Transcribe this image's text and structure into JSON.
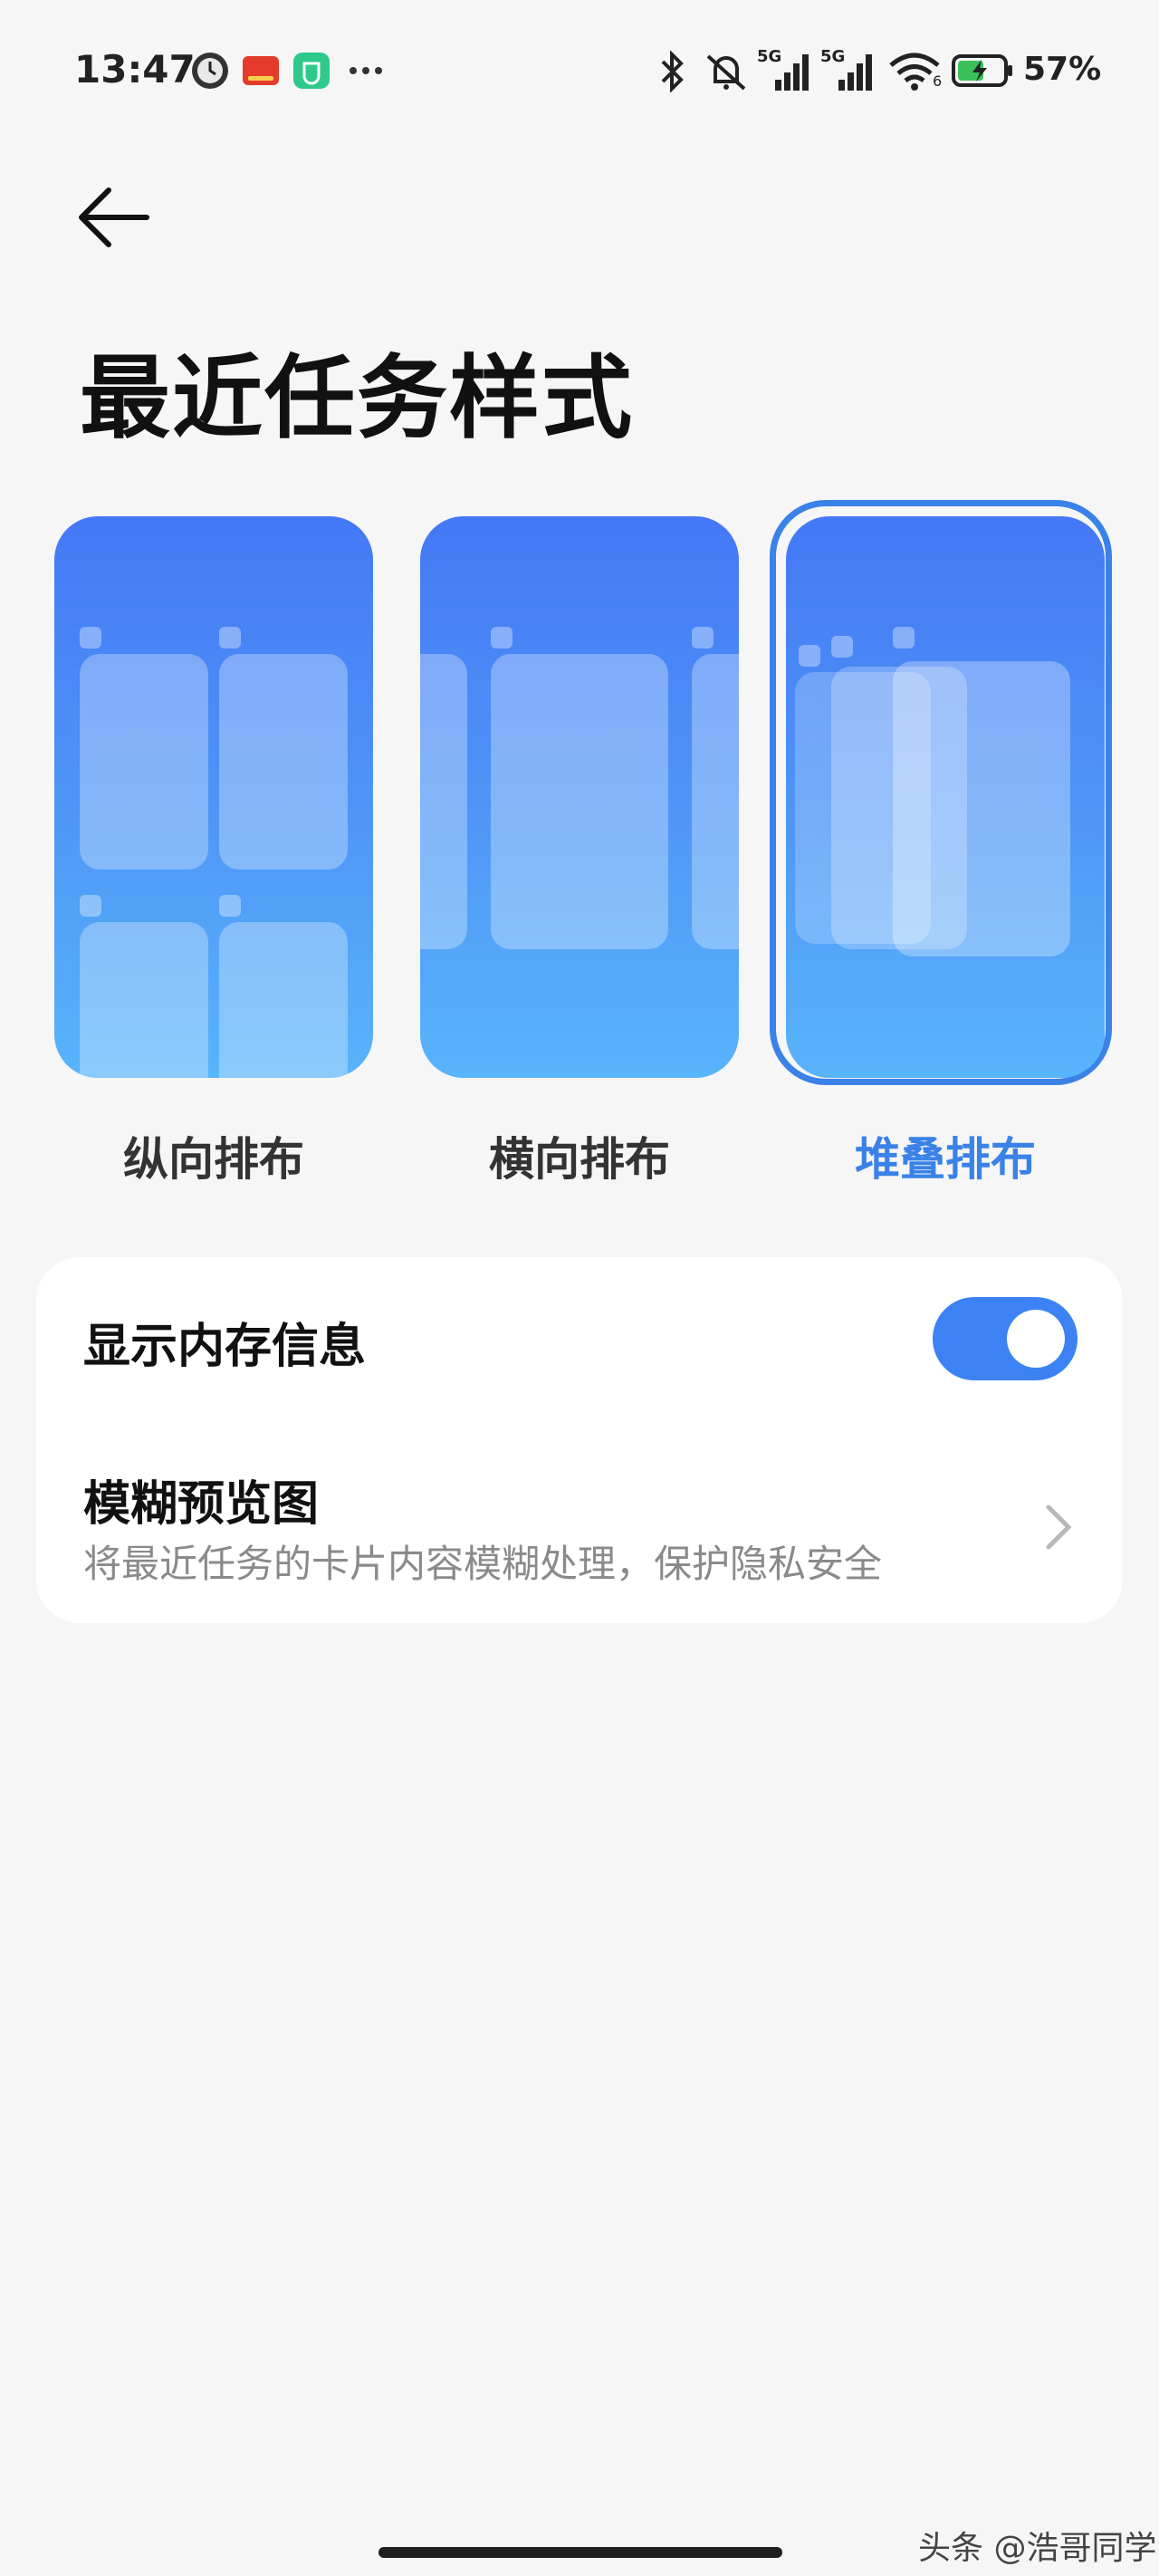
{
  "status_bar": {
    "time": "13:47",
    "network_1": "5G",
    "network_2": "5G",
    "wifi_badge": "6",
    "battery": "57%",
    "notification_icons": [
      "clock-app-icon",
      "toutiao-app-icon",
      "mijia-app-icon",
      "more-dots-icon"
    ],
    "system_icons": [
      "bluetooth-icon",
      "mute-icon",
      "signal-icon",
      "signal-icon",
      "wifi-icon",
      "battery-charging-icon"
    ]
  },
  "header": {
    "back_icon": "arrow-left-icon",
    "title": "最近任务样式"
  },
  "style_options": [
    {
      "label": "纵向排布",
      "selected": false
    },
    {
      "label": "横向排布",
      "selected": false
    },
    {
      "label": "堆叠排布",
      "selected": true
    }
  ],
  "settings": {
    "memory_info_label": "显示内存信息",
    "memory_info_enabled": true,
    "blur_preview_title": "模糊预览图",
    "blur_preview_subtitle": "将最近任务的卡片内容模糊处理，保护隐私安全"
  },
  "watermark": "头条 @浩哥同学",
  "colors": {
    "accent": "#3a82e8",
    "toggle_on": "#3c82f5",
    "background": "#f6f6f6",
    "card": "#ffffff"
  }
}
